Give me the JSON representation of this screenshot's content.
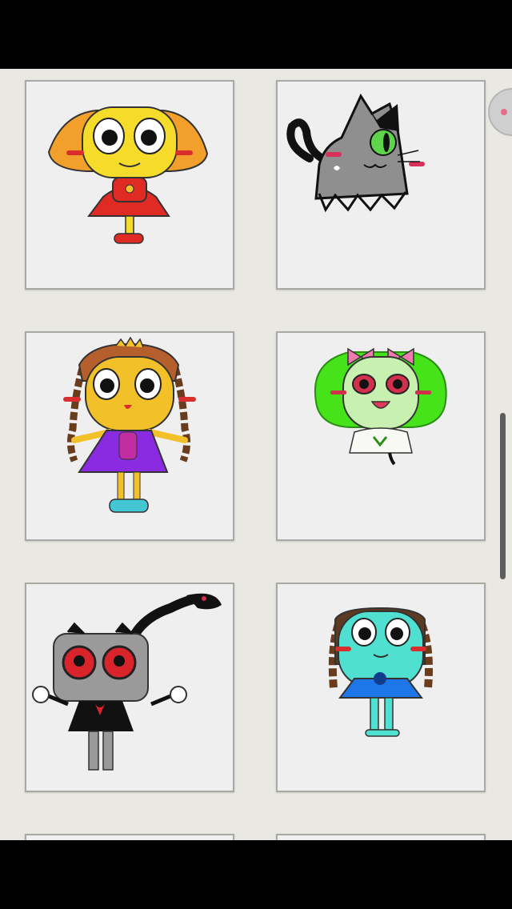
{
  "gallery": {
    "items": [
      {
        "icon": "yellow-character-orange-hair-red-dress"
      },
      {
        "icon": "gray-cat-green-eye"
      },
      {
        "icon": "yellow-character-braids-purple-dress"
      },
      {
        "icon": "green-haired-character-pink-bows"
      },
      {
        "icon": "gray-character-red-eyes-black-dress"
      },
      {
        "icon": "teal-character-brown-braids-blue-dress"
      }
    ]
  },
  "colors": {
    "background": "#e9e8e2",
    "card": "#efefef",
    "scrollbar": "#5d5d5d",
    "accent": "#e66a8a"
  }
}
